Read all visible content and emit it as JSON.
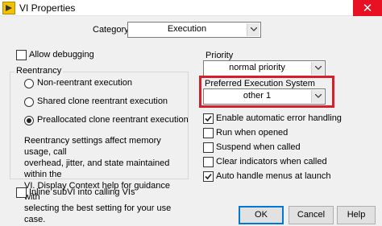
{
  "window": {
    "title": "VI Properties",
    "close_glyph": "✕",
    "icon": "labview-vi-icon"
  },
  "category": {
    "label": "Category",
    "value": "Execution"
  },
  "allow_debugging": {
    "label": "Allow debugging",
    "checked": false
  },
  "reentrancy": {
    "group_label": "Reentrancy",
    "options": [
      {
        "label": "Non-reentrant execution",
        "selected": false
      },
      {
        "label": "Shared clone reentrant execution",
        "selected": false
      },
      {
        "label": "Preallocated clone reentrant execution",
        "selected": true
      }
    ],
    "description_lines": [
      "Reentrancy settings affect memory usage, call",
      "overhead, jitter, and state maintained within the",
      "VI. Display Context help for guidance with",
      "selecting the best setting for your use case."
    ]
  },
  "inline_subvi": {
    "label": "Inline subVI into calling VIs",
    "checked": false
  },
  "priority": {
    "label": "Priority",
    "value": "normal priority"
  },
  "preferred_execution_system": {
    "label": "Preferred Execution System",
    "value": "other 1",
    "highlight_color": "#d51f2a"
  },
  "options": [
    {
      "label": "Enable automatic error handling",
      "checked": true
    },
    {
      "label": "Run when opened",
      "checked": false
    },
    {
      "label": "Suspend when called",
      "checked": false
    },
    {
      "label": "Clear indicators when called",
      "checked": false
    },
    {
      "label": "Auto handle menus at launch",
      "checked": true
    }
  ],
  "buttons": {
    "ok": "OK",
    "cancel": "Cancel",
    "help": "Help"
  },
  "colors": {
    "accent": "#0078d7",
    "close": "#e81123"
  }
}
